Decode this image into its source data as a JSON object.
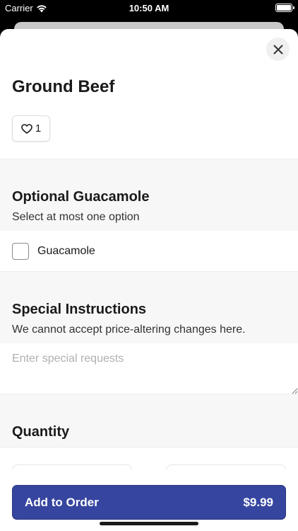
{
  "status_bar": {
    "carrier": "Carrier",
    "time": "10:50 AM"
  },
  "item": {
    "title": "Ground Beef",
    "like_count": "1"
  },
  "option_group": {
    "heading": "Optional Guacamole",
    "subheading": "Select at most one option",
    "options": [
      {
        "label": "Guacamole",
        "checked": false
      }
    ]
  },
  "instructions": {
    "heading": "Special Instructions",
    "subheading": "We cannot accept price-altering changes here.",
    "placeholder": "Enter special requests",
    "value": ""
  },
  "quantity": {
    "heading": "Quantity"
  },
  "footer": {
    "add_label": "Add to Order",
    "price": "$9.99",
    "accent_color": "#3646a0"
  },
  "icons": {
    "close": "close-icon",
    "like": "heart-icon",
    "wifi": "wifi-icon",
    "battery": "battery-icon"
  }
}
